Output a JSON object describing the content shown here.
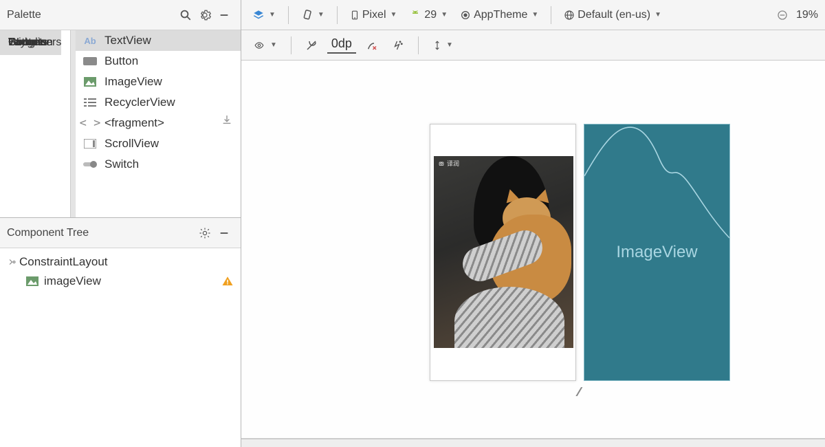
{
  "palette": {
    "title": "Palette",
    "categories": [
      "Common",
      "Text",
      "Buttons",
      "Widgets",
      "Layouts",
      "Containers",
      "Google"
    ],
    "selected_category": 0,
    "items": [
      "TextView",
      "Button",
      "ImageView",
      "RecyclerView",
      "<fragment>",
      "ScrollView",
      "Switch"
    ],
    "selected_item": 0
  },
  "component_tree": {
    "title": "Component Tree",
    "root": "ConstraintLayout",
    "children": [
      {
        "name": "imageView",
        "warning": true
      }
    ]
  },
  "config_bar": {
    "device": "Pixel",
    "api": "29",
    "theme": "AppTheme",
    "locale": "Default (en-us)",
    "zoom": "19%"
  },
  "design_toolbar": {
    "margin_default": "0dp"
  },
  "blueprint": {
    "placeholder_label": "ImageView"
  },
  "preview": {
    "watermark": "译润"
  }
}
